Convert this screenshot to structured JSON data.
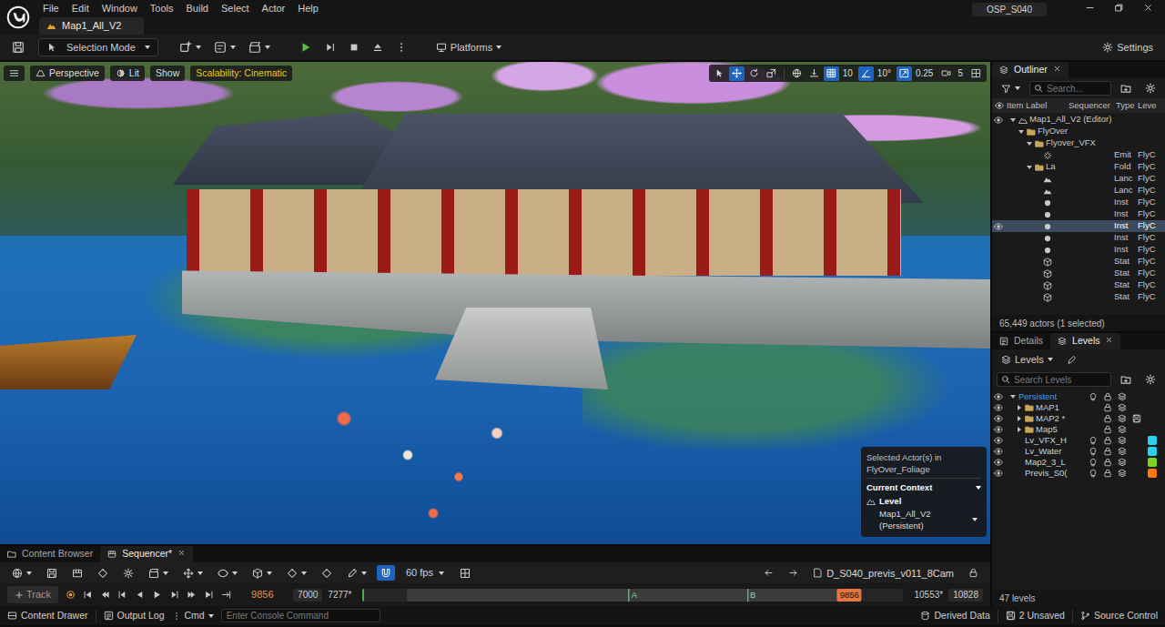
{
  "window": {
    "title": "Map1_All_V2",
    "project": "OSP_S040"
  },
  "menu": [
    "File",
    "Edit",
    "Window",
    "Tools",
    "Build",
    "Select",
    "Actor",
    "Help"
  ],
  "toolbar": {
    "mode": "Selection Mode",
    "platforms": "Platforms",
    "settings": "Settings"
  },
  "viewport": {
    "view": "Perspective",
    "lighting": "Lit",
    "show": "Show",
    "scalability": "Scalability: Cinematic",
    "tools": [
      {
        "kind": "select",
        "selected": false
      },
      {
        "kind": "translate",
        "selected": true
      },
      {
        "kind": "rotate",
        "selected": false
      },
      {
        "kind": "scale",
        "selected": false
      },
      {
        "kind": "world",
        "selected": false
      },
      {
        "kind": "surface",
        "selected": false
      }
    ],
    "snaps": [
      {
        "kind": "grid",
        "value": "10",
        "on": true
      },
      {
        "kind": "angle",
        "value": "10°",
        "on": true
      },
      {
        "kind": "scale",
        "value": "0.25",
        "on": true
      }
    ],
    "camera_speed": "5",
    "context": {
      "heading": "Selected Actor(s) in",
      "actor_level": "FlyOver_Foliage",
      "title": "Current Context",
      "label": "Level",
      "value": "Map1_All_V2 (Persistent)"
    }
  },
  "outliner": {
    "title": "Outliner",
    "search": {
      "placeholder": "Search..."
    },
    "columns": [
      "Item Label",
      "Sequencer",
      "Type",
      "Leve"
    ],
    "rows": [
      {
        "label": "Map1_All_V2 (Editor)",
        "kind": "world",
        "depth": 0,
        "expanded": true,
        "selected": false,
        "eye": true
      },
      {
        "label": "FlyOver",
        "kind": "folder",
        "depth": 1,
        "expanded": true,
        "selected": false,
        "eye": false
      },
      {
        "label": "Flyover_VFX",
        "kind": "folder",
        "depth": 2,
        "expanded": true,
        "selected": false,
        "eye": false
      },
      {
        "type": "Emit",
        "level": "FlyC",
        "kind": "emitter",
        "depth": 3,
        "expanded": false,
        "selected": false,
        "eye": false
      },
      {
        "label": "La",
        "type": "Fold",
        "level": "FlyC",
        "kind": "folder",
        "depth": 2,
        "expanded": true,
        "selected": false,
        "eye": false
      },
      {
        "type": "Lanc",
        "level": "FlyC",
        "kind": "landscape",
        "depth": 3,
        "expanded": false,
        "selected": false,
        "eye": false
      },
      {
        "type": "Lanc",
        "level": "FlyC",
        "kind": "landscape",
        "depth": 3,
        "expanded": false,
        "selected": false,
        "eye": false
      },
      {
        "type": "Inst",
        "level": "FlyC",
        "kind": "foliage",
        "depth": 3,
        "expanded": false,
        "selected": false,
        "eye": false
      },
      {
        "type": "Inst",
        "level": "FlyC",
        "kind": "foliage",
        "depth": 3,
        "expanded": false,
        "selected": false,
        "eye": false
      },
      {
        "type": "Inst",
        "level": "FlyC",
        "kind": "foliage",
        "depth": 3,
        "expanded": false,
        "selected": true,
        "eye": true
      },
      {
        "type": "Inst",
        "level": "FlyC",
        "kind": "foliage",
        "depth": 3,
        "expanded": false,
        "selected": false,
        "eye": false
      },
      {
        "type": "Inst",
        "level": "FlyC",
        "kind": "foliage",
        "depth": 3,
        "expanded": false,
        "selected": false,
        "eye": false
      },
      {
        "type": "Stat",
        "level": "FlyC",
        "kind": "static",
        "depth": 3,
        "expanded": false,
        "selected": false,
        "eye": false
      },
      {
        "type": "Stat",
        "level": "FlyC",
        "kind": "static",
        "depth": 3,
        "expanded": false,
        "selected": false,
        "eye": false
      },
      {
        "type": "Stat",
        "level": "FlyC",
        "kind": "static",
        "depth": 3,
        "expanded": false,
        "selected": false,
        "eye": false
      },
      {
        "type": "Stat",
        "level": "FlyC",
        "kind": "static",
        "depth": 3,
        "expanded": false,
        "selected": false,
        "eye": false
      }
    ],
    "footer": "65,449 actors (1 selected)"
  },
  "details_tabs": [
    {
      "label": "Details",
      "selected": false
    },
    {
      "label": "Levels",
      "selected": true
    }
  ],
  "levels": {
    "dropdown": "Levels",
    "search": {
      "placeholder": "Search Levels"
    },
    "rows": [
      {
        "name": "Persistent",
        "kind": "persistent",
        "depth": 0,
        "expanded": true,
        "visible": true,
        "dirty": false
      },
      {
        "name": "MAP1",
        "kind": "folder",
        "depth": 1,
        "expanded": false,
        "visible": true,
        "dirty": false
      },
      {
        "name": "MAP2 *",
        "kind": "folder",
        "depth": 1,
        "expanded": false,
        "visible": true,
        "dirty": true
      },
      {
        "name": "Map5",
        "kind": "folder",
        "depth": 1,
        "expanded": false,
        "visible": true,
        "dirty": false
      },
      {
        "name": "Lv_VFX_H",
        "kind": "level",
        "depth": 1,
        "expanded": false,
        "visible": true,
        "dirty": false,
        "color": "#29d3f0"
      },
      {
        "name": "Lv_Water",
        "kind": "level",
        "depth": 1,
        "expanded": false,
        "visible": true,
        "dirty": false,
        "color": "#29d3f0"
      },
      {
        "name": "Map2_3_L",
        "kind": "level",
        "depth": 1,
        "expanded": false,
        "visible": true,
        "dirty": false,
        "color": "#7ed321"
      },
      {
        "name": "Previs_S0(",
        "kind": "level",
        "depth": 1,
        "expanded": false,
        "visible": true,
        "dirty": false,
        "color": "#ff7a00"
      }
    ],
    "footer": "47 levels"
  },
  "bottom_tabs": [
    {
      "label": "Content Browser",
      "selected": false
    },
    {
      "label": "Sequencer*",
      "selected": true
    }
  ],
  "sequencer": {
    "snap": true,
    "fps": "60 fps",
    "sequence": "D_S040_previs_v011_8Cam",
    "locked": true,
    "track": "Track",
    "current_frame": "9856",
    "view_start": "7000",
    "range_start": "7277*",
    "markers": [
      {
        "label": "A",
        "level": 0.5
      },
      {
        "label": "B",
        "level": 0.72
      }
    ],
    "playhead": {
      "label": "9856",
      "level": 0.9
    },
    "range_end": "10553*",
    "view_end": "10828"
  },
  "status": {
    "drawer": "Content Drawer",
    "output": "Output Log",
    "cmd": "Cmd",
    "console": {
      "placeholder": "Enter Console Command"
    },
    "derived": "Derived Data",
    "unsaved": "2 Unsaved",
    "source": "Source Control"
  }
}
